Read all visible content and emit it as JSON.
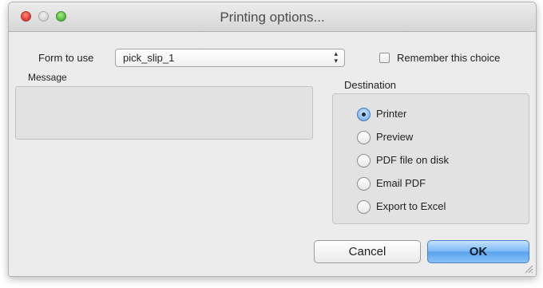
{
  "window": {
    "title": "Printing options..."
  },
  "form": {
    "label": "Form to use",
    "selected": "pick_slip_1",
    "remember_label": "Remember this choice",
    "remember_checked": false
  },
  "message": {
    "label": "Message",
    "value": ""
  },
  "destination": {
    "label": "Destination",
    "options": [
      {
        "label": "Printer",
        "selected": true
      },
      {
        "label": "Preview",
        "selected": false
      },
      {
        "label": "PDF file on disk",
        "selected": false
      },
      {
        "label": "Email PDF",
        "selected": false
      },
      {
        "label": "Export to Excel",
        "selected": false
      }
    ]
  },
  "buttons": {
    "cancel": "Cancel",
    "ok": "OK"
  },
  "icons": {
    "close": "close-icon",
    "minimize": "minimize-icon",
    "zoom": "zoom-icon",
    "select_arrows": "updown-arrows-icon",
    "grip": "resize-grip-icon"
  }
}
